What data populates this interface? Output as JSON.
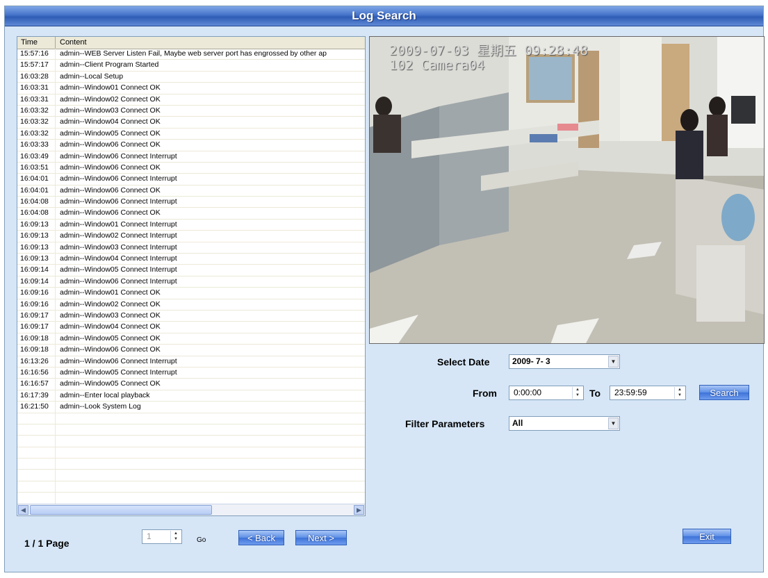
{
  "window": {
    "title": "Log Search"
  },
  "log_table": {
    "headers": {
      "time": "Time",
      "content": "Content"
    },
    "rows": [
      {
        "time": "15:57:16",
        "content": "admin--WEB Server Listen Fail, Maybe web server port has engrossed by other ap"
      },
      {
        "time": "15:57:17",
        "content": "admin--Client Program Started"
      },
      {
        "time": "16:03:28",
        "content": "admin--Local Setup"
      },
      {
        "time": "16:03:31",
        "content": "admin--Window01  Connect OK"
      },
      {
        "time": "16:03:31",
        "content": "admin--Window02  Connect OK"
      },
      {
        "time": "16:03:32",
        "content": "admin--Window03  Connect OK"
      },
      {
        "time": "16:03:32",
        "content": "admin--Window04  Connect OK"
      },
      {
        "time": "16:03:32",
        "content": "admin--Window05  Connect OK"
      },
      {
        "time": "16:03:33",
        "content": "admin--Window06  Connect OK"
      },
      {
        "time": "16:03:49",
        "content": "admin--Window06  Connect Interrupt"
      },
      {
        "time": "16:03:51",
        "content": "admin--Window06  Connect OK"
      },
      {
        "time": "16:04:01",
        "content": "admin--Window06  Connect Interrupt"
      },
      {
        "time": "16:04:01",
        "content": "admin--Window06  Connect OK"
      },
      {
        "time": "16:04:08",
        "content": "admin--Window06  Connect Interrupt"
      },
      {
        "time": "16:04:08",
        "content": "admin--Window06  Connect OK"
      },
      {
        "time": "16:09:13",
        "content": "admin--Window01  Connect Interrupt"
      },
      {
        "time": "16:09:13",
        "content": "admin--Window02  Connect Interrupt"
      },
      {
        "time": "16:09:13",
        "content": "admin--Window03  Connect Interrupt"
      },
      {
        "time": "16:09:13",
        "content": "admin--Window04  Connect Interrupt"
      },
      {
        "time": "16:09:14",
        "content": "admin--Window05  Connect Interrupt"
      },
      {
        "time": "16:09:14",
        "content": "admin--Window06  Connect Interrupt"
      },
      {
        "time": "16:09:16",
        "content": "admin--Window01  Connect OK"
      },
      {
        "time": "16:09:16",
        "content": "admin--Window02  Connect OK"
      },
      {
        "time": "16:09:17",
        "content": "admin--Window03  Connect OK"
      },
      {
        "time": "16:09:17",
        "content": "admin--Window04  Connect OK"
      },
      {
        "time": "16:09:18",
        "content": "admin--Window05  Connect OK"
      },
      {
        "time": "16:09:18",
        "content": "admin--Window06  Connect OK"
      },
      {
        "time": "16:13:26",
        "content": "admin--Window06  Connect Interrupt"
      },
      {
        "time": "16:16:56",
        "content": "admin--Window05  Connect Interrupt"
      },
      {
        "time": "16:16:57",
        "content": "admin--Window05  Connect OK"
      },
      {
        "time": "16:17:39",
        "content": "admin--Enter local playback"
      },
      {
        "time": "16:21:50",
        "content": "admin--Look System Log"
      }
    ]
  },
  "video": {
    "timestamp": "2009-07-03 星期五 09:28:48",
    "camera": "102 Camera04"
  },
  "form": {
    "select_date_label": "Select Date",
    "select_date_value": "2009- 7- 3",
    "from_label": "From",
    "from_value": "0:00:00",
    "to_label": "To",
    "to_value": "23:59:59",
    "search_button": "Search",
    "filter_label": "Filter Parameters",
    "filter_value": "All"
  },
  "pager": {
    "page_text": "1 / 1 Page",
    "page_input": "1",
    "go_label": "Go",
    "back_button": "< Back",
    "next_button": "Next >"
  },
  "exit_button": "Exit"
}
